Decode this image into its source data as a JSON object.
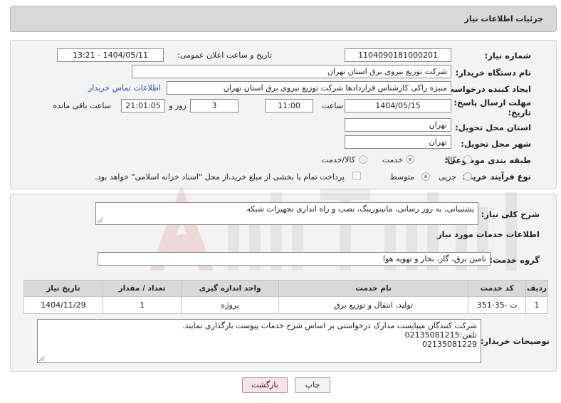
{
  "header": {
    "title": "جزئیات اطلاعات نیاز"
  },
  "form": {
    "need_number_label": "شماره نیاز:",
    "need_number": "1104090181000201",
    "announce_label": "تاریخ و ساعت اعلان عمومی:",
    "announce_value": "1404/05/11 - 13:21",
    "buyer_org_label": "نام دستگاه خریدار:",
    "buyer_org": "شرکت توزیع نیروی برق استان تهران",
    "creator_label": "ایجاد کننده درخواست:",
    "creator": "منیژه راکی کارشناس قراردادها شرکت توزیع نیروی برق استان تهران",
    "contact_link": "اطلاعات تماس خریدار",
    "deadline_label_1": "مهلت ارسال پاسخ: تا",
    "deadline_label_2": "تاریخ:",
    "deadline_date": "1404/05/15",
    "time_label": "ساعت",
    "deadline_time": "11:00",
    "days_value": "3",
    "days_label": "روز و",
    "remaining_time": "21:01:05",
    "remaining_label": "ساعت باقی مانده",
    "province_label": "استان محل تحویل:",
    "province": "تهران",
    "city_label": "شهر محل تحویل:",
    "city": "تهران",
    "category_label": "طبقه بندی موضوعی:",
    "category_options": [
      "کالا",
      "خدمت",
      "کالا/خدمت"
    ],
    "process_label": "نوع فرآیند خرید :",
    "process_options": [
      "جزیی",
      "متوسط"
    ],
    "payment_note": "پرداخت تمام یا بخشی از مبلغ خرید،از محل \"اسناد خزانه اسلامی\" خواهد بود."
  },
  "details": {
    "summary_label": "شرح کلی نیاز:",
    "summary": "پشتیبانی، به روز رسانی، مانیتورینگ، نصب و راه اندازی تجهیزات شبکه",
    "services_title": "اطلاعات خدمات مورد نیاز",
    "service_group_label": "گروه خدمت:",
    "service_group": "تامین برق، گاز، بخار و تهویه هوا",
    "table": {
      "headers": [
        "ردیف",
        "کد خدمت",
        "نام خدمت",
        "واحد اندازه گیری",
        "تعداد / مقدار",
        "تاریخ نیاز"
      ],
      "rows": [
        [
          "1",
          "ت -35-351",
          "تولید، انتقال و توزیع برق",
          "پروژه",
          "1",
          "1404/11/29"
        ]
      ]
    },
    "buyer_notes_label": "توضیحات خریدار:",
    "buyer_notes_line1": "شرکت کنندگان میبایست مدارک درخواستی بر اساس شرح خدمات پیوست بارگذاری نمایند.",
    "buyer_notes_line2": "تلفن:02135081215",
    "buyer_notes_line3": "02135081229"
  },
  "buttons": {
    "print": "چاپ",
    "back": "بازگشت"
  },
  "colors": {
    "link": "#1a55c9",
    "back_button_bg": "#fde3e3",
    "header_bg": "#d8d8d8"
  }
}
